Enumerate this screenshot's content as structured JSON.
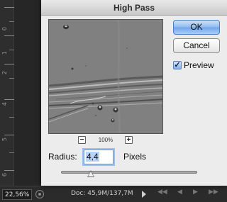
{
  "dialog": {
    "title": "High Pass",
    "ok_label": "OK",
    "cancel_label": "Cancel",
    "preview_label": "Preview",
    "preview_checked": true,
    "zoom_level": "100%",
    "zoom_out_symbol": "−",
    "zoom_in_symbol": "+",
    "radius_label": "Radius:",
    "radius_value": "4,4",
    "radius_units": "Pixels",
    "slider_position_fraction": 0.22
  },
  "ruler": {
    "labels": [
      "0",
      "1",
      "2",
      "3",
      "4",
      "5",
      "6"
    ]
  },
  "statusbar": {
    "zoom": "22,56%",
    "doc_info": "Doc: 45,9M/137,7M"
  },
  "colors": {
    "accent": "#6fa5eb",
    "dialog_bg": "#ececec",
    "app_bg": "#262626"
  }
}
